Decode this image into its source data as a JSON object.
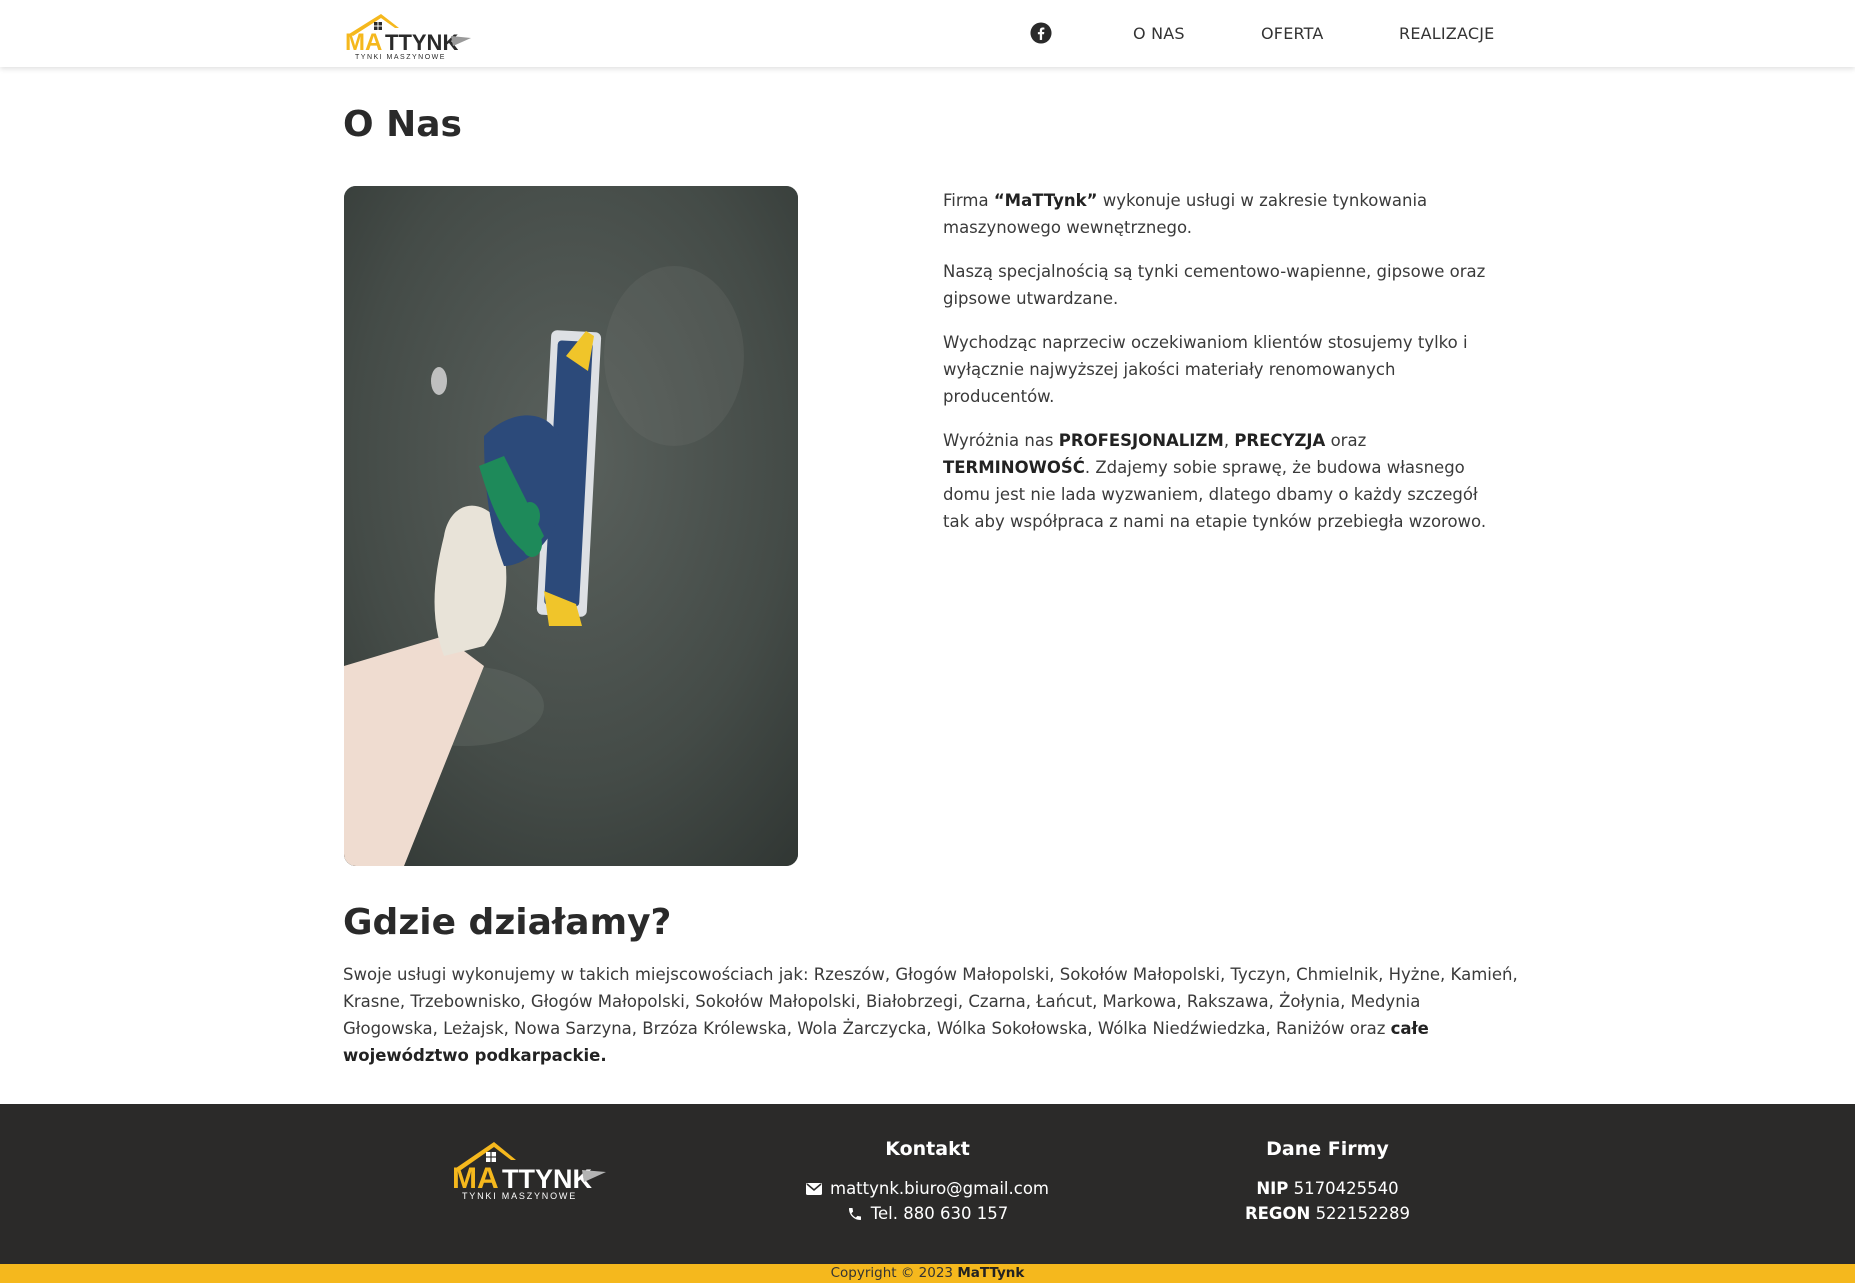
{
  "header": {
    "logo_text": "MATTYNK",
    "logo_subtext": "TYNKI MASZYNOWE",
    "facebook_icon": "facebook-icon",
    "nav": [
      {
        "label": "O NAS"
      },
      {
        "label": "OFERTA"
      },
      {
        "label": "REALIZACJE"
      }
    ]
  },
  "about": {
    "title": "O Nas",
    "p1_a": "Firma ",
    "p1_b": "“MaTTynk”",
    "p1_c": " wykonuje usługi w zakresie tynkowania maszynowego wewnętrznego.",
    "p2": "Naszą specjalnością są tynki cementowo-wapienne, gipsowe oraz gipsowe utwardzane.",
    "p3": "Wychodząc naprzeciw oczekiwaniom klientów stosujemy tylko i wyłącznie najwyższej jakości materiały renomowanych producentów.",
    "p4_a": "Wyróżnia nas ",
    "p4_b": "PROFESJONALIZM",
    "p4_c": ", ",
    "p4_d": "PRECYZJA",
    "p4_e": " oraz ",
    "p4_f": "TERMINOWOŚĆ",
    "p4_g": ". Zdajemy sobie sprawę, że budowa własnego domu jest nie lada wyzwaniem, dlatego dbamy o każdy szczegół tak aby współpraca z nami na etapie tynków przebiegła wzorowo."
  },
  "where": {
    "title": "Gdzie działamy?",
    "text": "Swoje usługi wykonujemy w takich miejscowościach jak: Rzeszów, Głogów Małopolski, Sokołów Małopolski, Tyczyn, Chmielnik, Hyżne, Kamień, Krasne, Trzebownisko, Głogów Małopolski, Sokołów Małopolski, Białobrzegi, Czarna, Łańcut, Markowa, Rakszawa, Żołynia, Medynia Głogowska, Leżajsk, Nowa Sarzyna, Brzóza Królewska, Wola Żarczycka, Wólka Sokołowska, Wólka Niedźwiedzka, Raniżów oraz ",
    "bold": "całe województwo podkarpackie."
  },
  "footer": {
    "contact_title": "Kontakt",
    "email": "mattynk.biuro@gmail.com",
    "phone": "Tel. 880 630 157",
    "company_title": "Dane Firmy",
    "nip_label": "NIP",
    "nip": "5170425540",
    "regon_label": "REGON",
    "regon": "522152289",
    "copyright": "Copyright © 2023 ",
    "copyright_brand": "MaTTynk"
  },
  "colors": {
    "accent": "#f5b81d",
    "footer_bg": "#2b2a29",
    "text": "#2a2a2a"
  }
}
